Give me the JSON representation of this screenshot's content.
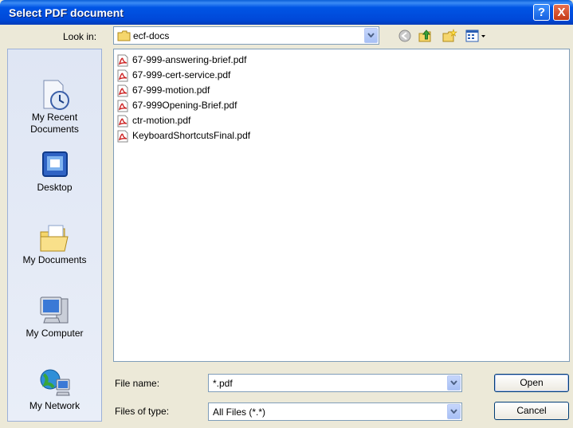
{
  "window": {
    "title": "Select PDF document",
    "help_glyph": "?",
    "close_glyph": "X"
  },
  "toolbar": {
    "look_in_label": "Look in:",
    "look_in_value": "ecf-docs",
    "icons": [
      "back-icon",
      "up-folder-icon",
      "new-folder-icon",
      "view-menu-icon"
    ]
  },
  "places": [
    {
      "label": "My Recent\nDocuments",
      "line1": "My Recent",
      "line2": "Documents",
      "icon": "recent-documents-icon"
    },
    {
      "label": "Desktop",
      "icon": "desktop-icon"
    },
    {
      "label": "My Documents",
      "icon": "my-documents-icon"
    },
    {
      "label": "My Computer",
      "icon": "my-computer-icon"
    },
    {
      "label": "My Network",
      "icon": "my-network-icon"
    }
  ],
  "files": [
    {
      "name": "67-999-answering-brief.pdf",
      "icon": "pdf-file-icon"
    },
    {
      "name": "67-999-cert-service.pdf",
      "icon": "pdf-file-icon"
    },
    {
      "name": "67-999-motion.pdf",
      "icon": "pdf-file-icon"
    },
    {
      "name": "67-999Opening-Brief.pdf",
      "icon": "pdf-file-icon"
    },
    {
      "name": "ctr-motion.pdf",
      "icon": "pdf-file-icon"
    },
    {
      "name": "KeyboardShortcutsFinal.pdf",
      "icon": "pdf-file-icon"
    }
  ],
  "form": {
    "file_name_label": "File name:",
    "file_name_value": "*.pdf",
    "file_type_label": "Files of type:",
    "file_type_value": "All Files (*.*)"
  },
  "buttons": {
    "open": "Open",
    "cancel": "Cancel"
  },
  "colors": {
    "titlebar": "#0055e5",
    "dialog_bg": "#ece9d8",
    "pdf_red": "#cc1f1f"
  }
}
